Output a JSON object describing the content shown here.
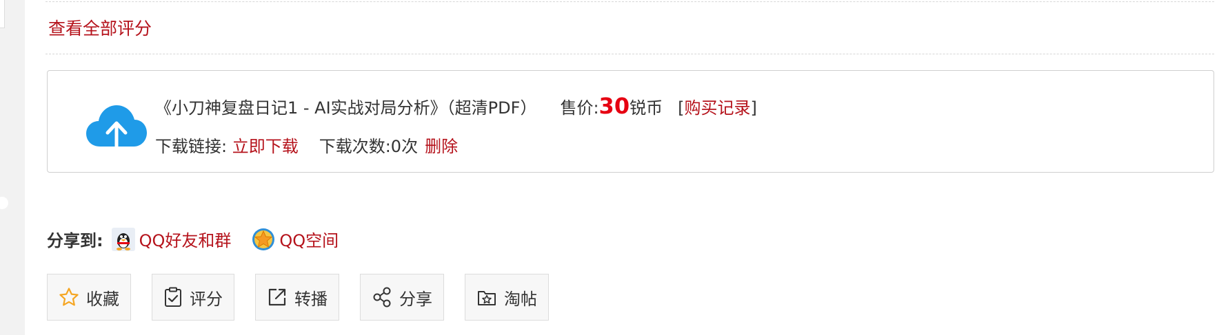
{
  "header": {
    "view_all_ratings": "查看全部评分"
  },
  "attachment": {
    "icon": "cloud-upload-icon",
    "title": "《小刀神复盘日记1 - AI实战对局分析》（超清PDF）",
    "price_label": "售价:",
    "price_value": "30",
    "price_unit": "锐币",
    "purchase_open": "[",
    "purchase_link": "购买记录",
    "purchase_close": "]",
    "download_label": "下载链接: ",
    "download_link": "立即下载",
    "download_count": "下载次数:0次",
    "delete_link": "删除"
  },
  "share": {
    "label": "分享到:",
    "qq_friends": "QQ好友和群",
    "qq_zone": "QQ空间"
  },
  "actions": [
    {
      "icon": "star-icon",
      "label": "收藏"
    },
    {
      "icon": "clipboard-check-icon",
      "label": "评分"
    },
    {
      "icon": "external-link-icon",
      "label": "转播"
    },
    {
      "icon": "share-icon",
      "label": "分享"
    },
    {
      "icon": "folder-star-icon",
      "label": "淘帖"
    }
  ],
  "colors": {
    "link_red": "#b5121b",
    "price_red": "#e60012",
    "cloud_blue": "#1f9be8",
    "star_orange": "#f5a623"
  }
}
